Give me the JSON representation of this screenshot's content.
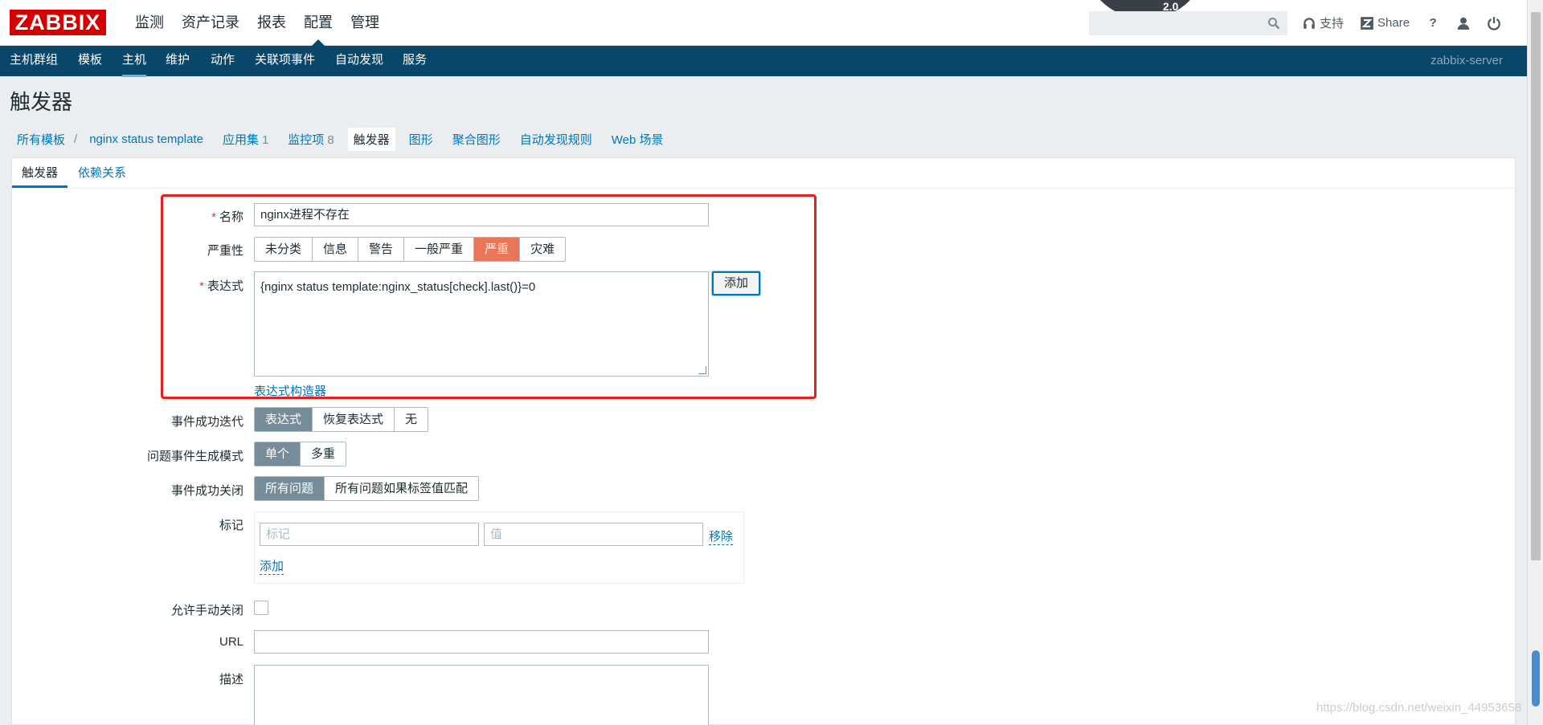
{
  "header": {
    "logo": "ZABBIX",
    "menu": [
      "监测",
      "资产记录",
      "报表",
      "配置",
      "管理"
    ],
    "active_menu": "配置",
    "gauge_text": "2.0",
    "search": {
      "value": "",
      "placeholder": ""
    },
    "support_label": "支持",
    "share_label": "Share",
    "help_icon": "?",
    "icons": [
      "search-icon",
      "headset-icon",
      "share-z-icon",
      "help-icon",
      "user-icon",
      "power-icon"
    ]
  },
  "subnav": {
    "items": [
      "主机群组",
      "模板",
      "主机",
      "维护",
      "动作",
      "关联项事件",
      "自动发现",
      "服务"
    ],
    "active": "主机",
    "server": "zabbix-server"
  },
  "page_title": "触发器",
  "breadcrumbs": {
    "all_templates": "所有模板",
    "separator": "/",
    "template": "nginx status template",
    "applications": {
      "label": "应用集",
      "count": "1"
    },
    "items": {
      "label": "监控项",
      "count": "8"
    },
    "triggers": "触发器",
    "graphs": "图形",
    "screens": "聚合图形",
    "discovery": "自动发现规则",
    "web": "Web 场景"
  },
  "tabs": {
    "trigger": "触发器",
    "dependencies": "依赖关系"
  },
  "form": {
    "required_mark": "*",
    "name_label": "名称",
    "name_value": "nginx进程不存在",
    "severity_label": "严重性",
    "severity_options": [
      "未分类",
      "信息",
      "警告",
      "一般严重",
      "严重",
      "灾难"
    ],
    "severity_selected": "严重",
    "expression_label": "表达式",
    "expression_value": "{nginx status template:nginx_status[check].last()}=0",
    "add_button": "添加",
    "expression_builder": "表达式构造器",
    "ok_event_gen_label": "事件成功迭代",
    "ok_event_gen_options": [
      "表达式",
      "恢复表达式",
      "无"
    ],
    "ok_event_gen_selected": "表达式",
    "problem_mode_label": "问题事件生成模式",
    "problem_mode_options": [
      "单个",
      "多重"
    ],
    "problem_mode_selected": "单个",
    "ok_close_label": "事件成功关闭",
    "ok_close_options": [
      "所有问题",
      "所有问题如果标签值匹配"
    ],
    "ok_close_selected": "所有问题",
    "tags_label": "标记",
    "tag_placeholder": "标记",
    "value_placeholder": "值",
    "remove_link": "移除",
    "add_tag_link": "添加",
    "manual_close_label": "允许手动关闭",
    "manual_close_checked": false,
    "url_label": "URL",
    "url_value": "",
    "description_label": "描述",
    "description_value": ""
  },
  "watermark": "https://blog.csdn.net/weixin_44953658",
  "colors": {
    "brand": "#d40000",
    "nav": "#0a466a",
    "link": "#0275b8",
    "severity_high": "#e97659",
    "highlight": "#e51f1f"
  }
}
